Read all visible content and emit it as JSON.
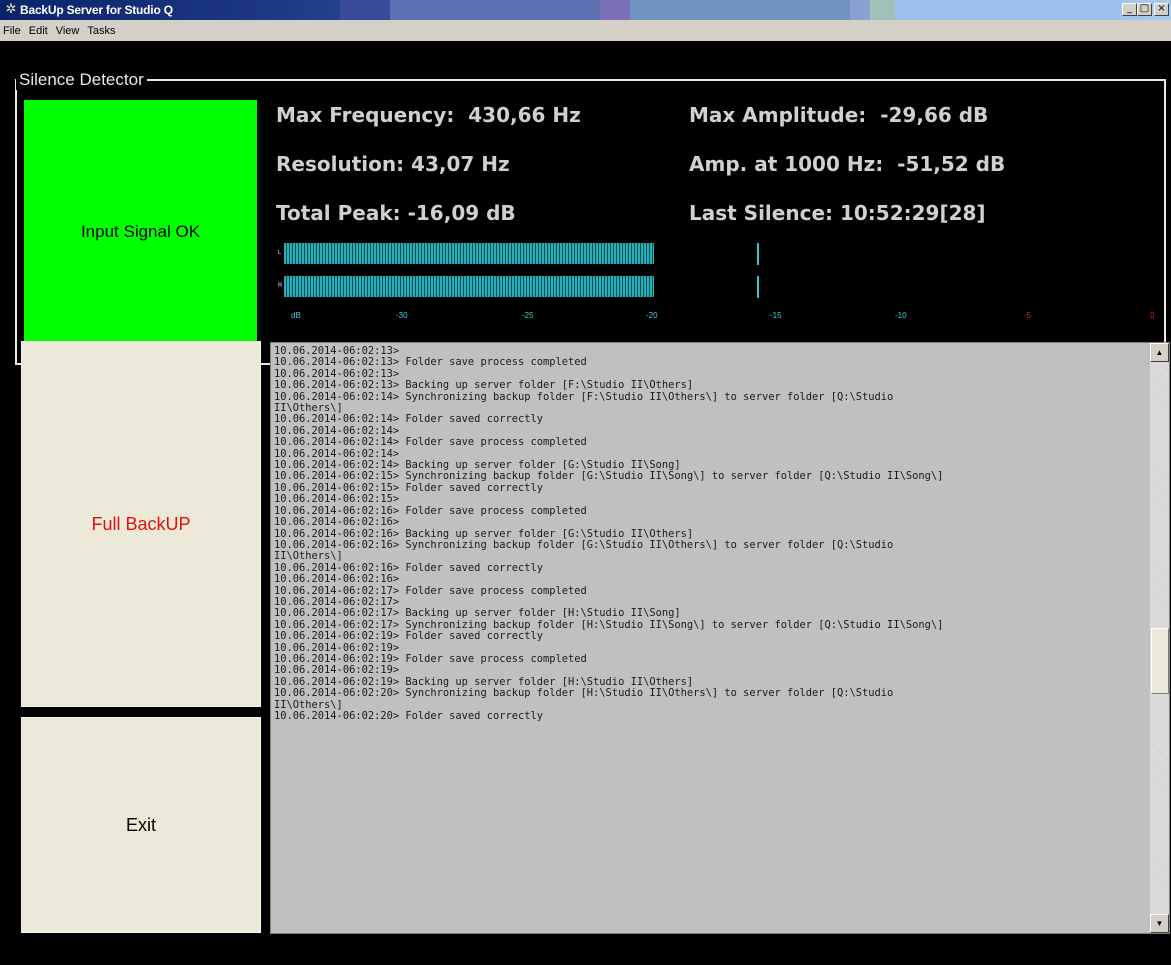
{
  "window": {
    "title": "BackUp Server for Studio Q",
    "icon": "gear-icon",
    "minimize": "_",
    "maximize": "□",
    "close": "×"
  },
  "menu": [
    "File",
    "Edit",
    "View",
    "Tasks"
  ],
  "silence_detector": {
    "title": "Silence Detector",
    "signal_status": "Input Signal OK",
    "signal_color": "#00ff00",
    "max_frequency": "Max Frequency:  430,66 Hz",
    "resolution": "Resolution: 43,07 Hz",
    "total_peak": "Total Peak: -16,09 dB",
    "max_amplitude": "Max Amplitude:  -29,66 dB",
    "amp_1000": "Amp. at 1000 Hz:  -51,52 dB",
    "last_silence": "Last Silence: 10:52:29[28]",
    "meter": {
      "left_label": "L",
      "right_label": "R",
      "scale": [
        "dB",
        "-30",
        "-25",
        "-20",
        "-15",
        "-10",
        "-5",
        "0"
      ],
      "left_level_db": -21,
      "right_level_db": -21,
      "left_peak_db": -16,
      "right_peak_db": -16
    }
  },
  "buttons": {
    "full_backup": "Full BackUP",
    "full_backup_color": "#e01010",
    "exit": "Exit"
  },
  "log": [
    "10.06.2014-06:02:13>",
    "10.06.2014-06:02:13> Folder save process completed",
    "10.06.2014-06:02:13>",
    "10.06.2014-06:02:13> Backing up server folder [F:\\Studio II\\Others]",
    "10.06.2014-06:02:14> Synchronizing backup folder [F:\\Studio II\\Others\\] to server folder [Q:\\Studio",
    "II\\Others\\]",
    "10.06.2014-06:02:14> Folder saved correctly",
    "10.06.2014-06:02:14>",
    "10.06.2014-06:02:14> Folder save process completed",
    "10.06.2014-06:02:14>",
    "10.06.2014-06:02:14> Backing up server folder [G:\\Studio II\\Song]",
    "10.06.2014-06:02:15> Synchronizing backup folder [G:\\Studio II\\Song\\] to server folder [Q:\\Studio II\\Song\\]",
    "10.06.2014-06:02:15> Folder saved correctly",
    "10.06.2014-06:02:15>",
    "10.06.2014-06:02:16> Folder save process completed",
    "10.06.2014-06:02:16>",
    "10.06.2014-06:02:16> Backing up server folder [G:\\Studio II\\Others]",
    "10.06.2014-06:02:16> Synchronizing backup folder [G:\\Studio II\\Others\\] to server folder [Q:\\Studio",
    "II\\Others\\]",
    "10.06.2014-06:02:16> Folder saved correctly",
    "10.06.2014-06:02:16>",
    "10.06.2014-06:02:17> Folder save process completed",
    "10.06.2014-06:02:17>",
    "10.06.2014-06:02:17> Backing up server folder [H:\\Studio II\\Song]",
    "10.06.2014-06:02:17> Synchronizing backup folder [H:\\Studio II\\Song\\] to server folder [Q:\\Studio II\\Song\\]",
    "10.06.2014-06:02:19> Folder saved correctly",
    "10.06.2014-06:02:19>",
    "10.06.2014-06:02:19> Folder save process completed",
    "10.06.2014-06:02:19>",
    "10.06.2014-06:02:19> Backing up server folder [H:\\Studio II\\Others]",
    "10.06.2014-06:02:20> Synchronizing backup folder [H:\\Studio II\\Others\\] to server folder [Q:\\Studio",
    "II\\Others\\]",
    "10.06.2014-06:02:20> Folder saved correctly"
  ],
  "scrollbar": {
    "up_icon": "scroll-up-arrow-icon",
    "down_icon": "scroll-down-arrow-icon",
    "up": "▲",
    "down": "▼"
  }
}
